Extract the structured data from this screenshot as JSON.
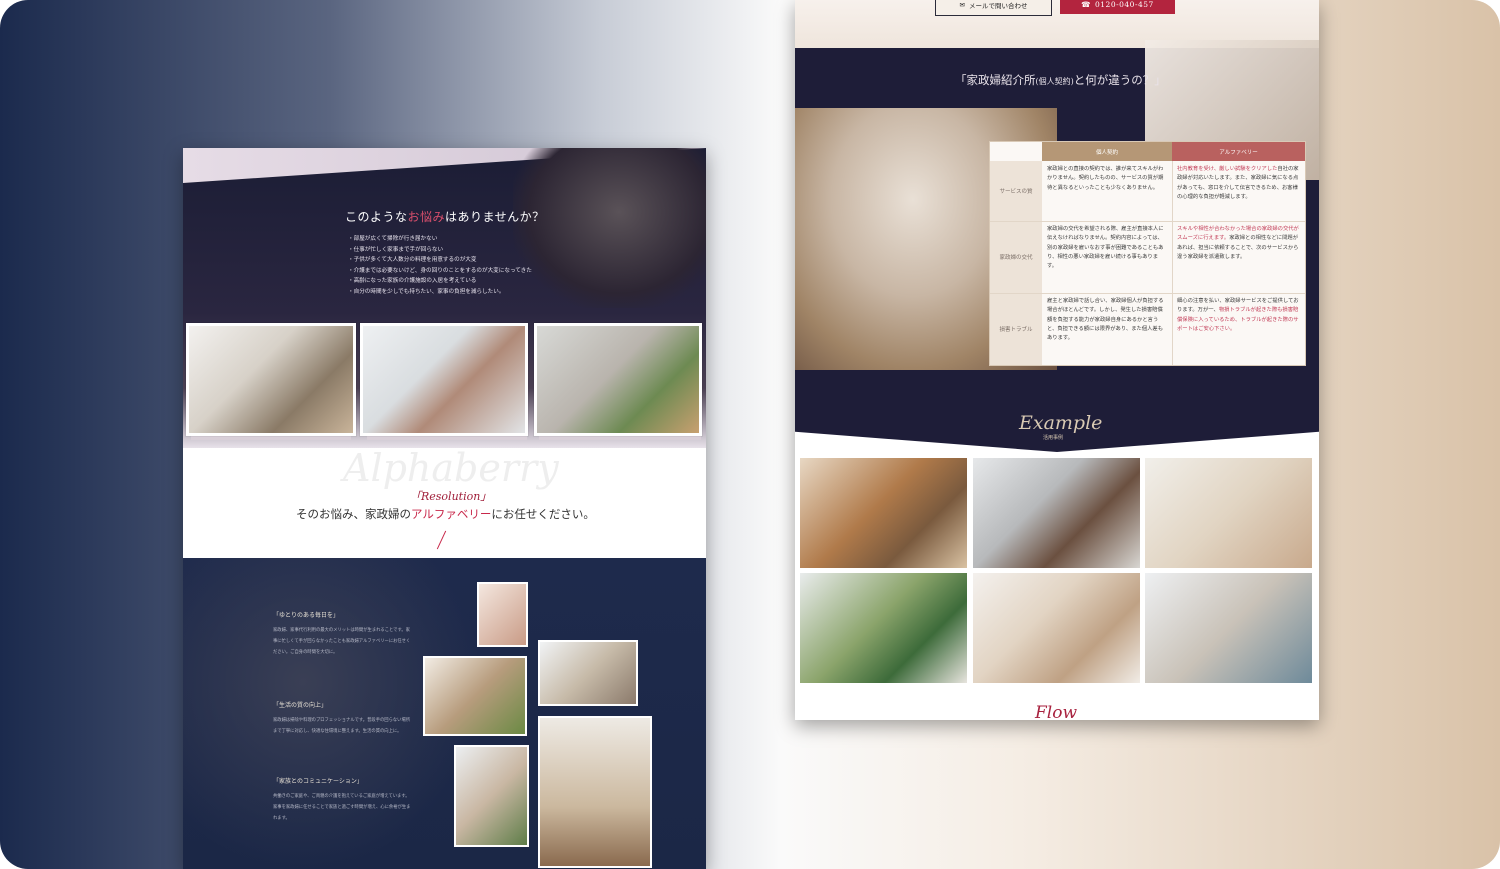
{
  "left_page": {
    "question_prefix": "このような",
    "question_accent": "お悩み",
    "question_suffix": "はありませんか？",
    "worries": [
      "・部屋が広くて掃除が行き届かない",
      "・仕事が忙しく家事まで手が回らない",
      "・子供が多くて大人数分の料理を用意するのが大変",
      "・介護までは必要ないけど、身の回りのことをするのが大変になってきた",
      "・高齢になった家族の介護施設の入居を考えている",
      "・自分の時間を少しでも持ちたい、家事の負担を減らしたい。"
    ],
    "watermark": "Alphaberry",
    "resolution_label": "「Resolution」",
    "resolution_prefix": "そのお悩み、家政婦の",
    "resolution_accent": "アルファベリー",
    "resolution_suffix": "にお任せください。",
    "features": [
      {
        "title": "「ゆとりのある毎日を」",
        "body": "家政婦、家事代行利用の最大のメリットは時間が生まれることです。家事に忙しくて手が回らなかったことも家政婦アルファベリーにお任せください。ご自身の時間を大切に。"
      },
      {
        "title": "「生活の質の向上」",
        "body": "家政婦は掃除や料理のプロフェッショナルです。普段手の回らない場所まで丁寧に対応し、快適な住環境に整えます。生活の質の向上に。"
      },
      {
        "title": "「家族とのコミュニケーション」",
        "body": "共働きのご家庭や、ご両親の介護を抱えているご家庭が増えています。家事を家政婦に任せることで家族と過ごす時間が増え、心に余裕が生まれます。"
      }
    ]
  },
  "right_page": {
    "mail_button": "メールで問い合わせ",
    "tel_button": "0120-040-457",
    "compare_title_a": "「家政婦紹介所",
    "compare_title_small": "(個人契約)",
    "compare_title_b": "と何が違うの？」",
    "table": {
      "col_private": "個人契約",
      "col_alphaberry": "アルファベリー",
      "rows": [
        {
          "label": "サービスの質",
          "private": "家政婦との直接の契約では、誰が来てスキルがわかりません。契約したものの、サービスの質が期待と異なるといったことも少なくありません。",
          "alpha_pink": "社内教育を受け、厳しい試験をクリアした",
          "alpha": "自社の家政婦が対応いたします。また、家政婦に気になる点があっても、窓口を介して伝言できるため、お客様の心理的な負担が軽減します。"
        },
        {
          "label": "家政婦の交代",
          "private": "家政婦の交代を希望される際、雇主が直接本人に伝えなければなりません。契約内容によっては、別の家政婦を雇いなおす事が困難であることもあり、相性の悪い家政婦を雇い続ける事もあります。",
          "alpha_pink": "スキルや相性が合わなかった場合の家政婦の交代がスムーズに行えます。",
          "alpha": "家政婦との相性などに問題があれば、担当に依頼することで、次のサービスから違う家政婦を派遣致します。"
        },
        {
          "label": "損害トラブル",
          "private": "雇主と家政婦で話し合い、家政婦個人が負担する場合がほとんどです。しかし、発生した損害賠償額を負担する能力が家政婦自身にあるかと言うと、負担できる額には限界があり、また個人差もあります。",
          "alpha_pink": "物損トラブルが起きた際も損害賠償保険に入っているため、トラブルが起きた際のサポートはご安心下さい。",
          "alpha": "細心の注意を払い、家政婦サービスをご提供しております。万が一、"
        }
      ]
    },
    "example_title": "Example",
    "example_sub": "活用事例",
    "flow_title": "Flow"
  },
  "icons": [
    "mail-icon",
    "phone-icon"
  ],
  "colors": {
    "navy": "#1e1d38",
    "accent": "#c8284a",
    "gold": "#b59776"
  }
}
